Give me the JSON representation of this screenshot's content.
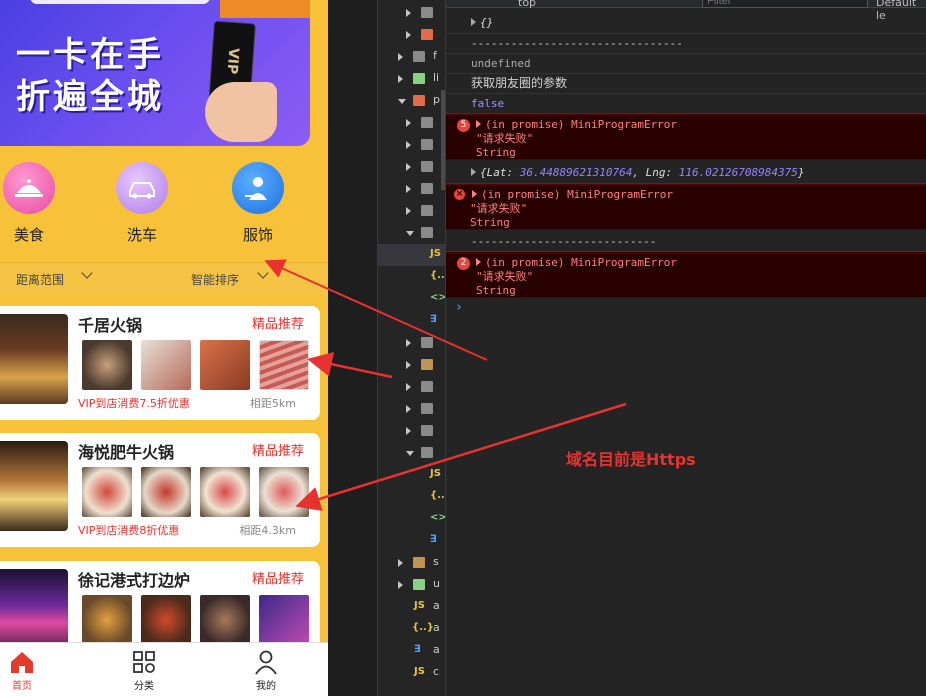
{
  "phone": {
    "banner_title_line1": "一卡在手",
    "banner_title_line2": "折遍全城",
    "card_text": "VIP",
    "categories": [
      {
        "label": "美食",
        "icon": "food-cloche-icon"
      },
      {
        "label": "洗车",
        "icon": "car-wash-icon"
      },
      {
        "label": "服饰",
        "icon": "clothing-icon"
      }
    ],
    "filters": {
      "distance": "距离范围",
      "sort": "智能排序"
    },
    "shops": [
      {
        "name": "千居火锅",
        "tag": "精品推荐",
        "promo": "VIP到店消费7.5折优惠",
        "distance": "相距5km"
      },
      {
        "name": "海悦肥牛火锅",
        "tag": "精品推荐",
        "promo": "VIP到店消费8折优惠",
        "distance": "相距4.3km"
      },
      {
        "name": "徐记港式打边炉",
        "tag": "精品推荐",
        "promo": "",
        "distance": ""
      }
    ],
    "tabs": [
      {
        "label": "首页",
        "icon": "home-icon",
        "active": true
      },
      {
        "label": "分类",
        "icon": "category-grid-icon",
        "active": false
      },
      {
        "label": "我的",
        "icon": "user-icon",
        "active": false
      }
    ]
  },
  "devtools": {
    "toolbar": {
      "context": "top",
      "filter_placeholder": "Filter",
      "levels": "Default le"
    },
    "console_lines": {
      "obj1": "{}",
      "sep1": "--------------------------------",
      "undefined": "undefined",
      "log_params": "获取朋友圈的参数",
      "false": "false",
      "err1_count": "5",
      "err1_title": "(in promise) MiniProgramError",
      "err1_msg": "\"请求失败\"",
      "err1_type": "String",
      "loc_prefix": "{Lat: ",
      "loc_lat": "36.44889621310764",
      "loc_mid": ", Lng: ",
      "loc_lng": "116.02126708984375",
      "loc_suffix": "}",
      "err2_title": "(in promise) MiniProgramError",
      "err2_msg": "\"请求失败\"",
      "err2_type": "String",
      "sep2": "----------------------------",
      "err3_count": "2",
      "err3_title": "(in promise) MiniProgramError",
      "err3_msg": "\"请求失败\"",
      "err3_type": "String",
      "prompt": "›"
    },
    "tree_labels": [
      "f",
      "li",
      "p",
      "s",
      "u",
      "a",
      "a",
      "a",
      "c"
    ]
  },
  "annotation": "域名目前是Https",
  "colors": {
    "accent_red": "#e8322f",
    "phone_bg": "#f7c23a",
    "console_error_bg": "#290000"
  }
}
